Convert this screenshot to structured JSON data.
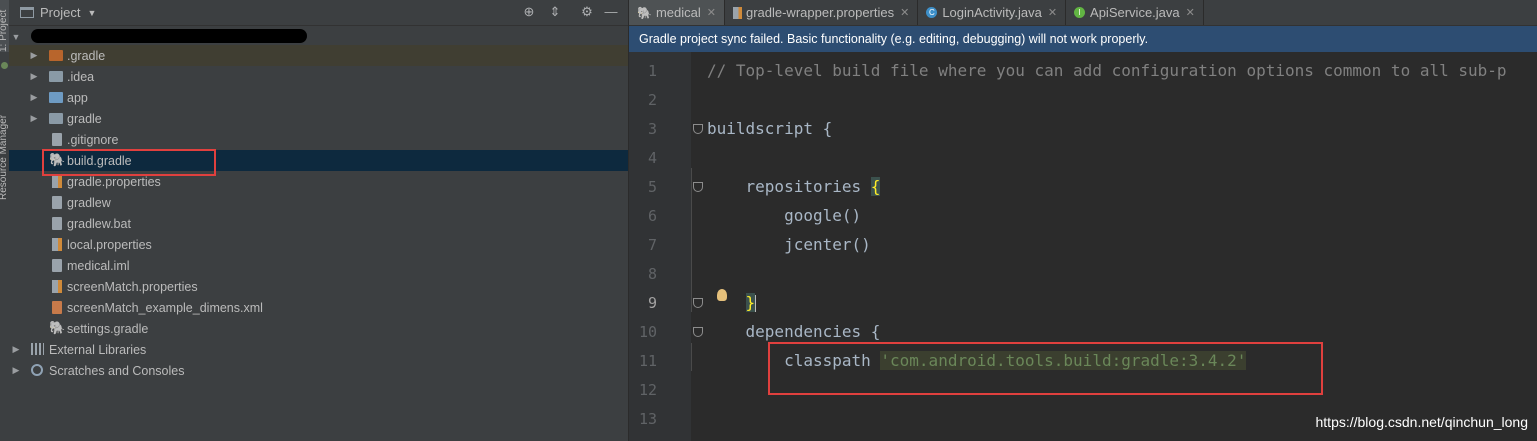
{
  "toolstrip": {
    "project_tab": "1: Project",
    "resource_manager_tab": "Resource Manager"
  },
  "project_panel": {
    "title": "Project",
    "tree": [
      {
        "label": ".gradle",
        "icon": "folder-orange",
        "expandable": true
      },
      {
        "label": ".idea",
        "icon": "folder",
        "expandable": true
      },
      {
        "label": "app",
        "icon": "folder-blue",
        "expandable": true
      },
      {
        "label": "gradle",
        "icon": "folder",
        "expandable": true
      },
      {
        "label": ".gitignore",
        "icon": "file",
        "expandable": false
      },
      {
        "label": "build.gradle",
        "icon": "gradle-elephant",
        "expandable": false,
        "selected": true
      },
      {
        "label": "gradle.properties",
        "icon": "properties",
        "expandable": false
      },
      {
        "label": "gradlew",
        "icon": "file",
        "expandable": false
      },
      {
        "label": "gradlew.bat",
        "icon": "file",
        "expandable": false
      },
      {
        "label": "local.properties",
        "icon": "properties",
        "expandable": false
      },
      {
        "label": "medical.iml",
        "icon": "file",
        "expandable": false
      },
      {
        "label": "screenMatch.properties",
        "icon": "properties",
        "expandable": false
      },
      {
        "label": "screenMatch_example_dimens.xml",
        "icon": "xml-file",
        "expandable": false
      },
      {
        "label": "settings.gradle",
        "icon": "gradle-elephant",
        "expandable": false
      },
      {
        "label": "External Libraries",
        "icon": "library",
        "expandable": true,
        "root": true
      },
      {
        "label": "Scratches and Consoles",
        "icon": "scratches",
        "expandable": true,
        "root": true
      }
    ]
  },
  "editor": {
    "tabs": [
      {
        "label": "medical",
        "icon": "gradle-elephant",
        "active": true
      },
      {
        "label": "gradle-wrapper.properties",
        "icon": "properties",
        "active": false
      },
      {
        "label": "LoginActivity.java",
        "icon": "class",
        "active": false
      },
      {
        "label": "ApiService.java",
        "icon": "interface",
        "active": false
      }
    ],
    "banner": "Gradle project sync failed. Basic functionality (e.g. editing, debugging) will not work properly.",
    "line_numbers": [
      "1",
      "2",
      "3",
      "4",
      "5",
      "6",
      "7",
      "8",
      "9",
      "10",
      "11",
      "12",
      "13"
    ],
    "current_line": "9",
    "lines": {
      "l1": "// Top-level build file where you can add configuration options common to all sub-p",
      "l3": "buildscript {",
      "l5_a": "    repositories ",
      "l5_b": "{",
      "l6": "        google()",
      "l7": "        jcenter()",
      "l9_pre": "    ",
      "l9_b": "}",
      "l10": "    dependencies {",
      "l11_a": "        classpath ",
      "l11_b": "'com.android.tools.build:gradle:3.4.2'"
    }
  },
  "watermark": "https://blog.csdn.net/qinchun_long",
  "colors": {
    "background": "#2b2b2b",
    "panel": "#3c3f41",
    "selection": "#0d293e",
    "banner": "#2d4d72",
    "highlight_box": "#e0403e",
    "string": "#6a8759",
    "comment": "#808080"
  }
}
